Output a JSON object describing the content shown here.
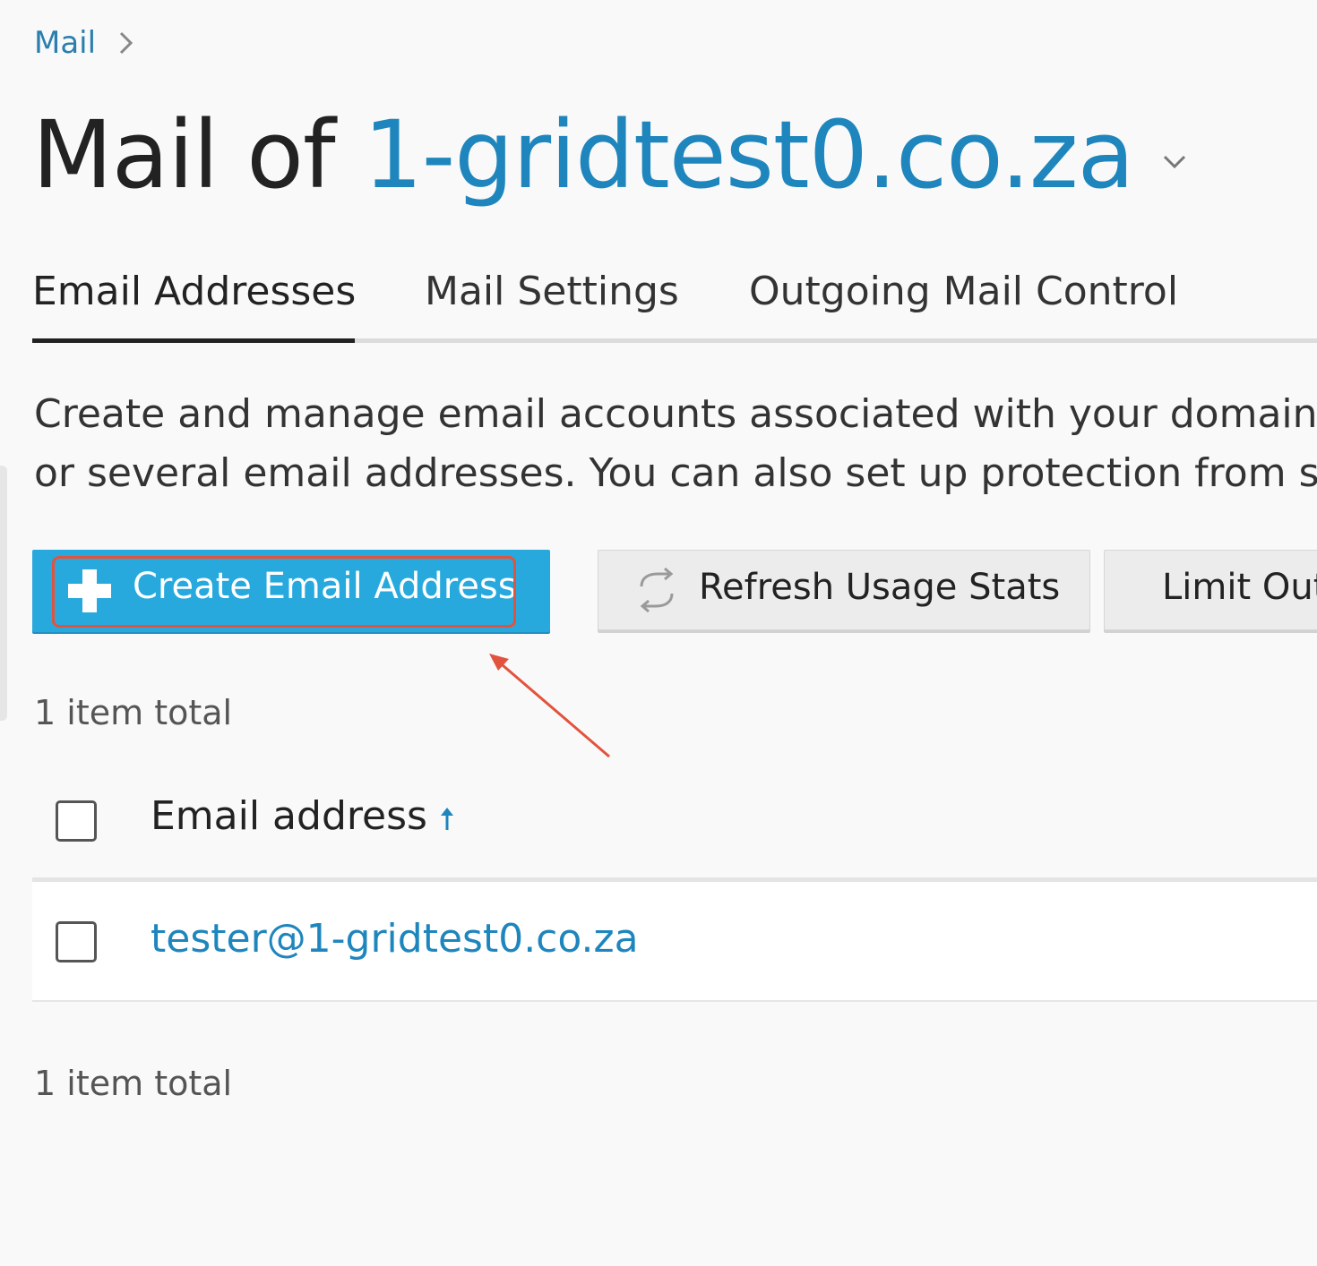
{
  "breadcrumb": {
    "items": [
      "Mail"
    ]
  },
  "title": {
    "prefix": "Mail of ",
    "domain": "1-gridtest0.co.za"
  },
  "tabs": [
    {
      "label": "Email Addresses",
      "active": true
    },
    {
      "label": "Mail Settings",
      "active": false
    },
    {
      "label": "Outgoing Mail Control",
      "active": false
    }
  ],
  "description": {
    "line1": "Create and manage email accounts associated with your domains. F",
    "line2": "or several email addresses. You can also set up protection from spa"
  },
  "toolbar": {
    "create_label": "Create Email Address",
    "refresh_label": "Refresh Usage Stats",
    "limit_label": "Limit Out"
  },
  "list": {
    "count_top": "1 item total",
    "count_bottom": "1 item total",
    "column_email": "Email address",
    "sort": "ascending",
    "rows": [
      {
        "email": "tester@1-gridtest0.co.za",
        "checked": false
      }
    ]
  },
  "colors": {
    "accent": "#28a9de",
    "link": "#1f86bd",
    "annotation": "#e2533d"
  },
  "icons": {
    "breadcrumb_separator": "chevron-right-icon",
    "title_dropdown": "chevron-down-icon",
    "create": "plus-icon",
    "refresh": "refresh-icon",
    "sort": "arrow-up-icon"
  }
}
